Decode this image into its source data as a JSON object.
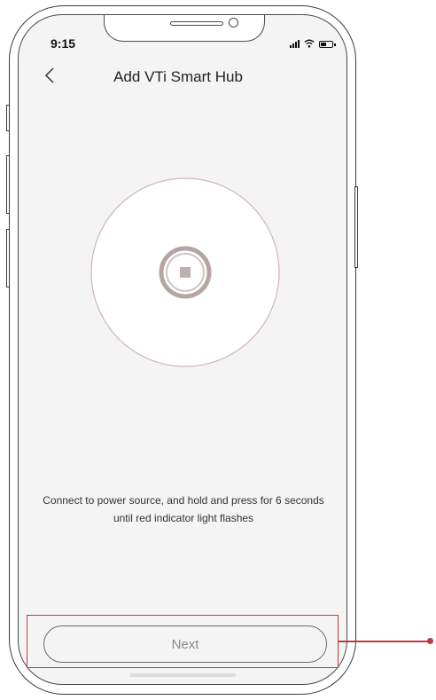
{
  "status_bar": {
    "time": "9:15",
    "icons": [
      "cellular-signal-icon",
      "wifi-icon",
      "battery-icon"
    ]
  },
  "nav": {
    "back_icon": "chevron-left-icon",
    "title": "Add VTi Smart Hub"
  },
  "illustration": {
    "icon": "smart-hub-icon"
  },
  "instruction": {
    "text": "Connect to power source, and hold and press for 6 seconds until red indicator light flashes"
  },
  "next_button": {
    "label": "Next"
  },
  "colors": {
    "screen_bg": "#f4f4f4",
    "highlight": "#c0393b",
    "button_text": "#8a8a8a"
  }
}
